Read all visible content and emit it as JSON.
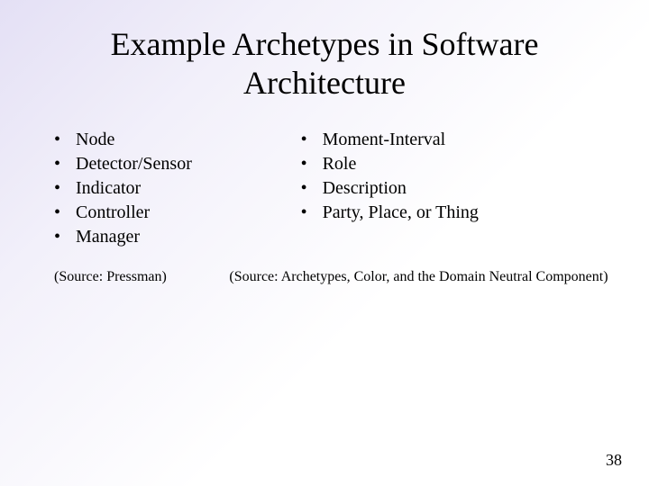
{
  "title": "Example Archetypes in Software Architecture",
  "left_list": {
    "items": [
      "Node",
      "Detector/Sensor",
      "Indicator",
      "Controller",
      "Manager"
    ],
    "source": "(Source: Pressman)"
  },
  "right_list": {
    "items": [
      "Moment-Interval",
      "Role",
      "Description",
      "Party, Place, or Thing"
    ],
    "source": "(Source: Archetypes, Color, and the Domain Neutral Component)"
  },
  "page_number": "38"
}
